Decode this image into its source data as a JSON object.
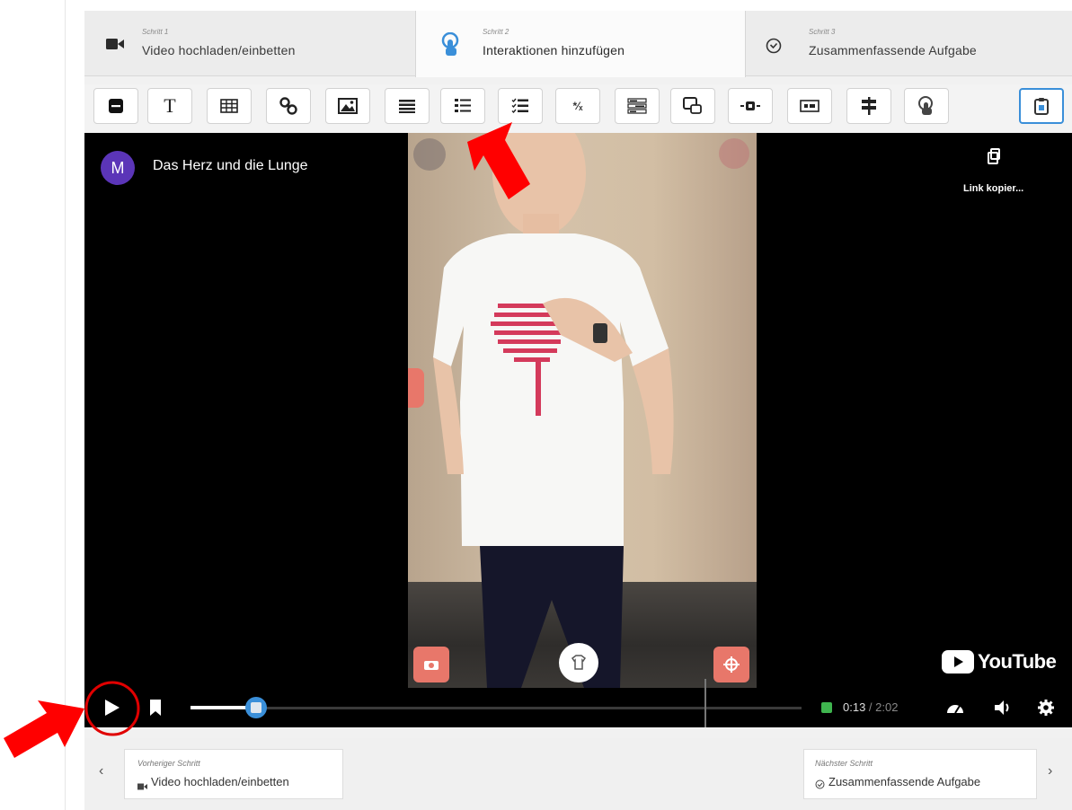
{
  "steps": [
    {
      "small": "Schritt 1",
      "label": "Video hochladen/einbetten",
      "icon": "video-camera-icon"
    },
    {
      "small": "Schritt 2",
      "label": "Interaktionen hinzufügen",
      "icon": "touch-pointer-icon"
    },
    {
      "small": "Schritt 3",
      "label": "Zusammenfassende Aufgabe",
      "icon": "check-circle-icon"
    }
  ],
  "toolbar": {
    "tools": [
      "label-tool",
      "text-tool",
      "table-tool",
      "link-tool",
      "image-tool",
      "statements-tool",
      "single-choice-tool",
      "multiple-choice-tool",
      "fill-blanks-tool",
      "drag-text-tool",
      "drag-drop-tool",
      "mark-words-tool",
      "free-text-tool",
      "crossroads-tool",
      "navigation-hotspot-tool",
      "paste-tool"
    ]
  },
  "video": {
    "channel_avatar": "M",
    "title": "Das Herz und die Lunge",
    "copy_link": "Link kopier...",
    "youtube": "YouTube",
    "current_time": "0:13",
    "duration": "2:02",
    "progress": 0.107
  },
  "nav": {
    "prev_small": "Vorheriger Schritt",
    "prev_label": "Video hochladen/einbetten",
    "next_small": "Nächster Schritt",
    "next_label": "Zusammenfassende Aufgabe",
    "prev_arrow": "‹",
    "next_arrow": "›"
  },
  "colors": {
    "annotation": "#ff0000",
    "avatar": "#5b35b8",
    "slider": "#3a8fd9",
    "accent_blue": "#3a8fd9",
    "hotspot": "#e8776a"
  }
}
